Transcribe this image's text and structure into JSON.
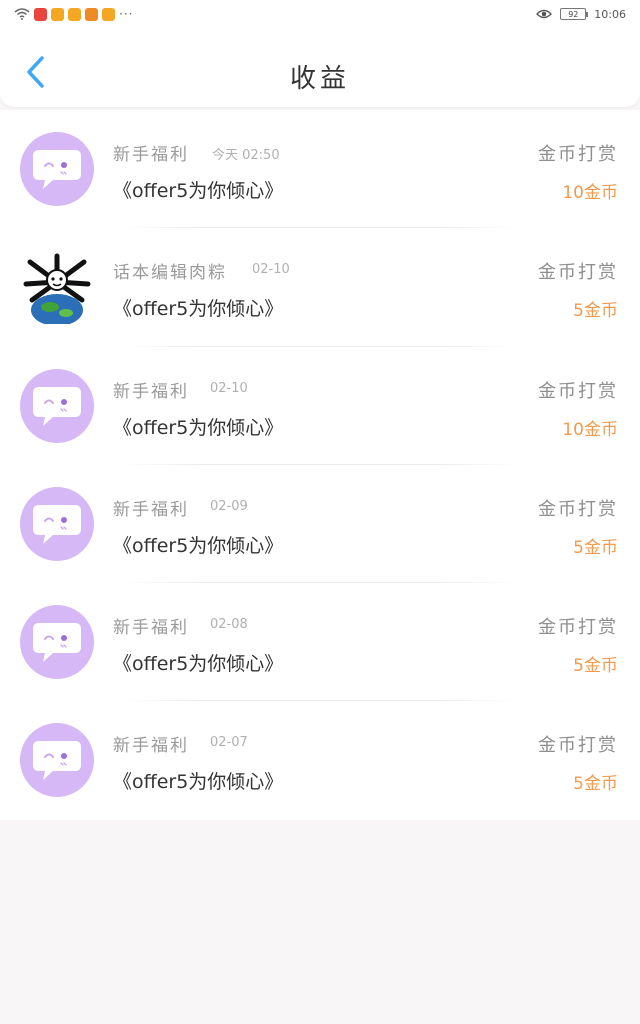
{
  "status_bar": {
    "time": "10:06",
    "battery": "92",
    "more": "···",
    "app_icons": [
      {
        "name": "weibo-icon",
        "color": "#f5a623"
      },
      {
        "name": "app-red-icon",
        "color": "#e8453c"
      },
      {
        "name": "weibo-icon",
        "color": "#f5a623"
      },
      {
        "name": "weibo-icon",
        "color": "#f5a623"
      },
      {
        "name": "app-orange-icon",
        "color": "#f08a24"
      },
      {
        "name": "weibo-icon",
        "color": "#f5a623"
      }
    ]
  },
  "header": {
    "title": "收益",
    "back_icon": "chevron-left-icon",
    "accent": "#3fa9f5"
  },
  "records": [
    {
      "sender": "新手福利",
      "time": "今天 02:50",
      "content": "《offer5为你倾心》",
      "type": "金币打赏",
      "amount": "10金币",
      "avatar": "chat-bubble"
    },
    {
      "sender": "话本编辑肉粽",
      "time": "02-10",
      "content": "《offer5为你倾心》",
      "type": "金币打赏",
      "amount": "5金币",
      "avatar": "user-avatar"
    },
    {
      "sender": "新手福利",
      "time": "02-10",
      "content": "《offer5为你倾心》",
      "type": "金币打赏",
      "amount": "10金币",
      "avatar": "chat-bubble"
    },
    {
      "sender": "新手福利",
      "time": "02-09",
      "content": "《offer5为你倾心》",
      "type": "金币打赏",
      "amount": "5金币",
      "avatar": "chat-bubble"
    },
    {
      "sender": "新手福利",
      "time": "02-08",
      "content": "《offer5为你倾心》",
      "type": "金币打赏",
      "amount": "5金币",
      "avatar": "chat-bubble"
    },
    {
      "sender": "新手福利",
      "time": "02-07",
      "content": "《offer5为你倾心》",
      "type": "金币打赏",
      "amount": "5金币",
      "avatar": "chat-bubble"
    }
  ],
  "colors": {
    "avatar_bg": "#d5b8f5",
    "amount": "#f39a4e",
    "page_bg": "#f8f6f7"
  }
}
